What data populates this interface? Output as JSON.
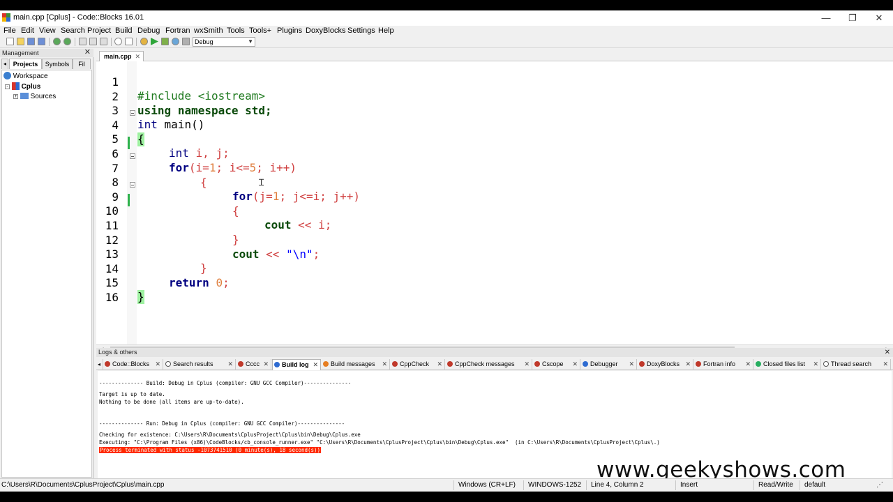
{
  "window": {
    "title": "main.cpp [Cplus] - Code::Blocks 16.01",
    "minimize": "—",
    "restore": "❐",
    "close": "✕"
  },
  "menu": [
    "File",
    "Edit",
    "View",
    "Search",
    "Project",
    "Build",
    "Debug",
    "Fortran",
    "wxSmith",
    "Tools",
    "Tools+",
    "Plugins",
    "DoxyBlocks",
    "Settings",
    "Help"
  ],
  "toolbar": {
    "build_target": "Debug"
  },
  "management": {
    "header": "Management",
    "tabs": [
      "Projects",
      "Symbols",
      "Fil"
    ],
    "tree": {
      "workspace": "Workspace",
      "project": "Cplus",
      "folder": "Sources"
    }
  },
  "editor": {
    "tab": "main.cpp",
    "lines": [
      {
        "n": "1"
      },
      {
        "n": "2"
      },
      {
        "n": "3"
      },
      {
        "n": "4"
      },
      {
        "n": "5"
      },
      {
        "n": "6"
      },
      {
        "n": "7"
      },
      {
        "n": "8"
      },
      {
        "n": "9"
      },
      {
        "n": "10"
      },
      {
        "n": "11"
      },
      {
        "n": "12"
      },
      {
        "n": "13"
      },
      {
        "n": "14"
      },
      {
        "n": "15"
      },
      {
        "n": "16"
      }
    ],
    "code": {
      "l1": "#include <iostream>",
      "l2_kw1": "using",
      "l2_kw2": "namespace",
      "l2_rest": "std;",
      "l3_kw": "int",
      "l3_rest": " main()",
      "l4": "{",
      "l5_kw": "int",
      "l5_rest": " i, j;",
      "l6_kw": "for",
      "l6_a": "(i=",
      "l6_n1": "1",
      "l6_b": "; i<=",
      "l6_n2": "5",
      "l6_c": "; i++)",
      "l7": "{",
      "l8_kw": "for",
      "l8_rest": "(j=",
      "l8_n1": "1",
      "l8_b": "; j<=i; j++)",
      "l9": "{",
      "l10_kw": "cout",
      "l10_rest": " << i;",
      "l11": "}",
      "l12_kw": "cout",
      "l12_a": " << ",
      "l12_str": "\"\\n\"",
      "l12_b": ";",
      "l13": "}",
      "l14_kw": "return",
      "l14_n": "0",
      "l14_b": ";",
      "l15": "}"
    }
  },
  "logs": {
    "header": "Logs & others",
    "tabs": [
      "Code::Blocks",
      "Search results",
      "Cccc",
      "Build log",
      "Build messages",
      "CppCheck",
      "CppCheck messages",
      "Cscope",
      "Debugger",
      "DoxyBlocks",
      "Fortran info",
      "Closed files list",
      "Thread search"
    ],
    "lines": [
      "-------------- Build: Debug in Cplus (compiler: GNU GCC Compiler)---------------",
      "Target is up to date.",
      "Nothing to be done (all items are up-to-date).",
      "-------------- Run: Debug in Cplus (compiler: GNU GCC Compiler)---------------",
      "Checking for existence: C:\\Users\\R\\Documents\\CplusProject\\Cplus\\bin\\Debug\\Cplus.exe",
      "Executing: \"C:\\Program Files (x86)\\CodeBlocks/cb_console_runner.exe\" \"C:\\Users\\R\\Documents\\CplusProject\\Cplus\\bin\\Debug\\Cplus.exe\"  (in C:\\Users\\R\\Documents\\CplusProject\\Cplus\\.)",
      "Process terminated with status -1073741510 (0 minute(s), 18 second(s))"
    ]
  },
  "watermark": "www.geekyshows.com",
  "status": {
    "path": "C:\\Users\\R\\Documents\\CplusProject\\Cplus\\main.cpp",
    "eol": "Windows (CR+LF)",
    "encoding": "WINDOWS-1252",
    "position": "Line 4, Column 2",
    "mode": "Insert",
    "access": "Read/Write",
    "lang": "default"
  },
  "colors": {
    "keyword": "#0a4a0a",
    "error_bg": "#ff2a00",
    "change_bar": "#2fb24d",
    "brace_match": "#9ef0a0"
  }
}
